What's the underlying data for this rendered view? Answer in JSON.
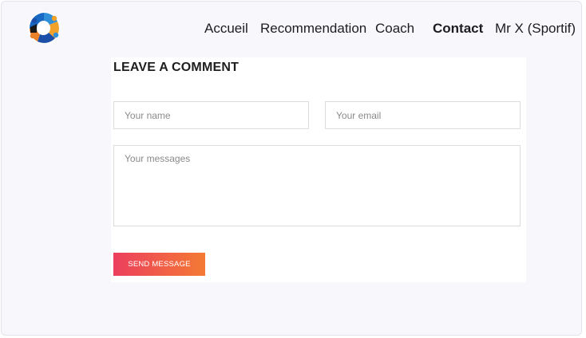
{
  "header": {
    "logo_icon": "colorful-circular-people-logo-icon",
    "nav": [
      {
        "label": "Accueil",
        "active": false
      },
      {
        "label": "Recommendation",
        "active": false
      },
      {
        "label": "Coach",
        "active": false
      },
      {
        "label": "Contact",
        "active": true
      },
      {
        "label": "Mr X (Sportif)",
        "active": false
      }
    ]
  },
  "comment_form": {
    "title": "LEAVE A COMMENT",
    "name_placeholder": "Your name",
    "email_placeholder": "Your email",
    "message_placeholder": "Your messages",
    "submit_label": "SEND MESSAGE"
  },
  "colors": {
    "page_background": "#f8f7fc",
    "button_gradient_start": "#ec3f5e",
    "button_gradient_end": "#f47a34"
  }
}
